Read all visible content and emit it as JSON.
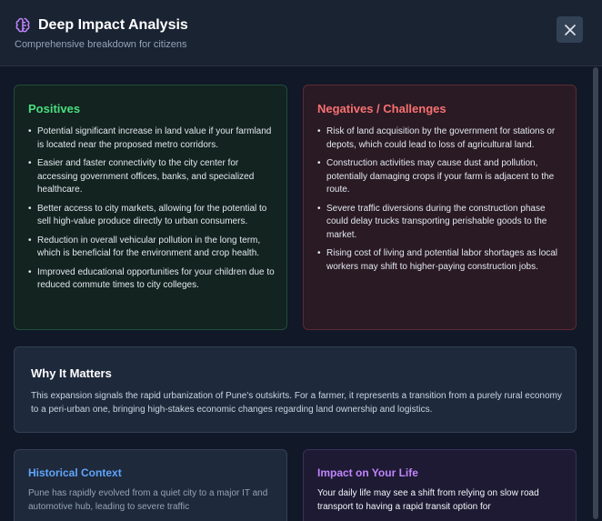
{
  "header": {
    "title": "Deep Impact Analysis",
    "subtitle": "Comprehensive breakdown for citizens",
    "icon": "brain-icon",
    "accent": "#c084fc"
  },
  "positives": {
    "title": "Positives",
    "color": "#4ade80",
    "items": [
      "Potential significant increase in land value if your farmland is located near the proposed metro corridors.",
      "Easier and faster connectivity to the city center for accessing government offices, banks, and specialized healthcare.",
      "Better access to city markets, allowing for the potential to sell high-value produce directly to urban consumers.",
      "Reduction in overall vehicular pollution in the long term, which is beneficial for the environment and crop health.",
      "Improved educational opportunities for your children due to reduced commute times to city colleges."
    ]
  },
  "negatives": {
    "title": "Negatives / Challenges",
    "color": "#f87171",
    "items": [
      "Risk of land acquisition by the government for stations or depots, which could lead to loss of agricultural land.",
      "Construction activities may cause dust and pollution, potentially damaging crops if your farm is adjacent to the route.",
      "Severe traffic diversions during the construction phase could delay trucks transporting perishable goods to the market.",
      "Rising cost of living and potential labor shortages as local workers may shift to higher-paying construction jobs."
    ]
  },
  "why": {
    "title": "Why It Matters",
    "text": "This expansion signals the rapid urbanization of Pune's outskirts. For a farmer, it represents a transition from a purely rural economy to a peri-urban one, bringing high-stakes economic changes regarding land ownership and logistics."
  },
  "historical": {
    "title": "Historical Context",
    "color": "#60a5fa",
    "text": "Pune has rapidly evolved from a quiet city to a major IT and automotive hub, leading to severe traffic"
  },
  "impact": {
    "title": "Impact on Your Life",
    "color": "#c084fc",
    "text": "Your daily life may see a shift from relying on slow road transport to having a rapid transit option for"
  }
}
